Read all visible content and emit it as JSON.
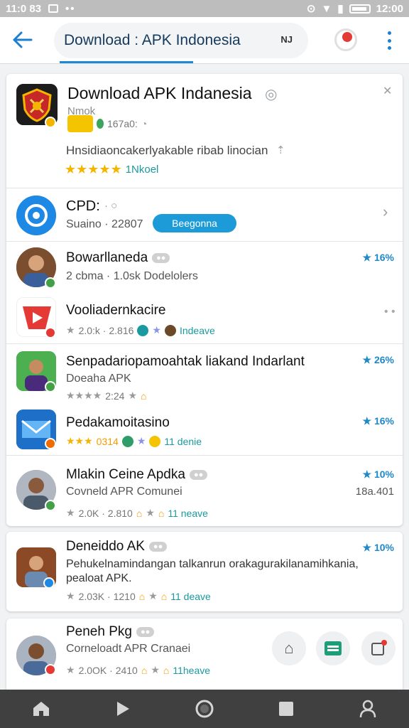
{
  "status_bar": {
    "time_left": "11:0 83",
    "time_right": "12:00"
  },
  "header": {
    "title": "Download : APK Indonesia",
    "tag": "NJ"
  },
  "featured": {
    "title": "Download APK Indanesia",
    "sub1": "Nmok",
    "version": "167a0:",
    "description": "Hnsidiaoncakerlyakable ribab linocian",
    "rating_label": "1Nkoel"
  },
  "cpd_row": {
    "label": "CPD:",
    "sub": "Suaino · 22807",
    "button": "Beegonna"
  },
  "items": [
    {
      "name": "Bowarllaneda",
      "sub": "2 cbma · 1.0sk  Dodelolers",
      "score": "★ 16%"
    },
    {
      "name": "Vooliadernkacire",
      "meta": "2.0:k · 2.816",
      "link": "Indeave"
    },
    {
      "name": "Senpadariopamoahtak liakand Indarlant",
      "sub": "Doeaha APK",
      "meta": "2:24",
      "score": "★ 26%"
    },
    {
      "name": "Pedakamoitasino",
      "meta": "0314",
      "link": "11 denie",
      "score": "★ 16%"
    },
    {
      "name": "Mlakin Ceine Apdka",
      "sub": "Covneld APR Comunei",
      "meta": "2.0K · 2.810",
      "link": "11 neave",
      "score": "★ 10%",
      "extra": "18a.401"
    },
    {
      "name": "Deneiddo AK",
      "sub": "Pehukelnamindangan talkanrun orakagurakilanamihkania, pealoat APK.",
      "meta": "2.03K · 1210",
      "link": "11 deave",
      "score": "★ 10%"
    },
    {
      "name": "Peneh Pkg",
      "sub": "Corneloadt APR Cranaei",
      "meta": "2.0OK · 2410",
      "link": "11heave"
    }
  ],
  "colors": {
    "accent": "#1e7fd0",
    "score": "#1e88c8",
    "star": "#f5b400",
    "nav": "#404040"
  }
}
